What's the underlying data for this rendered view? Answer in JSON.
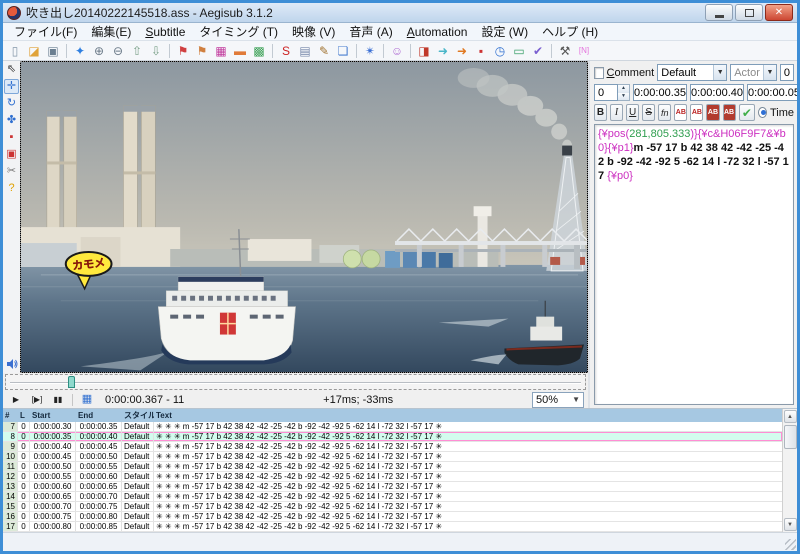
{
  "colors": {
    "accent_blue": "#3e8ed6",
    "grid_header_bg": "#a6c8e2",
    "selection_bg": "#d3fcee",
    "selection_border": "#ff8dd4",
    "tag_color": "#cc2fc0",
    "number_color": "#2f9e4f",
    "bubble_yellow": "#ffe93d",
    "bubble_text_red": "#d42a1e"
  },
  "window": {
    "title": "吹き出し20140222145518.ass - Aegisub 3.1.2"
  },
  "menu": {
    "items": [
      {
        "label": "ファイル(F)",
        "ak": false
      },
      {
        "label": "編集(E)",
        "ak": false
      },
      {
        "label": "Subtitle",
        "ak": true
      },
      {
        "label": "タイミング (T)",
        "ak": false
      },
      {
        "label": "映像 (V)",
        "ak": false
      },
      {
        "label": "音声 (A)",
        "ak": false
      },
      {
        "label": "Automation",
        "ak": true
      },
      {
        "label": "設定 (W)",
        "ak": false
      },
      {
        "label": "ヘルプ (H)",
        "ak": false
      }
    ]
  },
  "toolbar": {
    "items": [
      {
        "name": "new-file-icon",
        "glyph": "▯",
        "color": "#8496a8"
      },
      {
        "name": "open-file-icon",
        "glyph": "◪",
        "color": "#e0a33a"
      },
      {
        "name": "save-file-icon",
        "glyph": "▣",
        "color": "#6b7f91"
      },
      {
        "sep": true
      },
      {
        "name": "jump-to-icon",
        "glyph": "✦",
        "color": "#2f7fe0"
      },
      {
        "name": "zoom-in-icon",
        "glyph": "⊕",
        "color": "#6b7a88"
      },
      {
        "name": "zoom-out-icon",
        "glyph": "⊖",
        "color": "#6b7a88"
      },
      {
        "name": "sort-start-icon",
        "glyph": "⇧",
        "color": "#7aa089"
      },
      {
        "name": "sort-end-icon",
        "glyph": "⇩",
        "color": "#7aa089"
      },
      {
        "sep": true
      },
      {
        "name": "keyframe-prev-icon",
        "glyph": "⚑",
        "color": "#d04040"
      },
      {
        "name": "keyframe-next-icon",
        "glyph": "⚑",
        "color": "#d08040"
      },
      {
        "name": "styles-manager-icon",
        "glyph": "▦",
        "color": "#c23c9e"
      },
      {
        "name": "attachments-icon",
        "glyph": "▬",
        "color": "#e07b39"
      },
      {
        "name": "resample-resolution-icon",
        "glyph": "▩",
        "color": "#3aa055"
      },
      {
        "sep": true
      },
      {
        "name": "spell-checker-icon",
        "glyph": "S",
        "color": "#cc2222"
      },
      {
        "name": "script-properties-icon",
        "glyph": "▤",
        "color": "#7788aa"
      },
      {
        "name": "styling-assistant-icon",
        "glyph": "✎",
        "color": "#a0722f"
      },
      {
        "name": "translation-assistant-icon",
        "glyph": "❏",
        "color": "#4a7fd0"
      },
      {
        "sep": true
      },
      {
        "name": "automation-icon",
        "glyph": "✴",
        "color": "#3a6fd4"
      },
      {
        "sep": true
      },
      {
        "name": "about-icon",
        "glyph": "☺",
        "color": "#b06fd4"
      },
      {
        "sep": true
      },
      {
        "name": "shift-times-icon",
        "glyph": "◨",
        "color": "#c0392b"
      },
      {
        "name": "timing-postprocessor-icon",
        "glyph": "➜",
        "color": "#49b6c8"
      },
      {
        "name": "kanji-timer-icon",
        "glyph": "➜",
        "color": "#e07820"
      },
      {
        "name": "snap-icon",
        "glyph": "▪",
        "color": "#cc3333"
      },
      {
        "name": "shift-clock-icon",
        "glyph": "◷",
        "color": "#2f6fd0"
      },
      {
        "name": "script-resolution-icon",
        "glyph": "▭",
        "color": "#3aa06a"
      },
      {
        "name": "check-updates-icon",
        "glyph": "✔",
        "color": "#7a5fd0"
      },
      {
        "sep": true
      },
      {
        "name": "options-icon",
        "glyph": "⚒",
        "color": "#555555"
      },
      {
        "name": "toggle-tags-icon",
        "glyph": "[N]",
        "color": "#e473dd"
      }
    ]
  },
  "video_tools": {
    "items": [
      {
        "name": "cursor-tool-icon",
        "glyph": "⇖",
        "color": "#333333",
        "selected": false
      },
      {
        "name": "drag-tool-icon",
        "glyph": "✛",
        "color": "#2f6fd0",
        "selected": true
      },
      {
        "name": "rotate-z-tool-icon",
        "glyph": "↻",
        "color": "#2f6fd0",
        "selected": false
      },
      {
        "name": "rotate-xy-tool-icon",
        "glyph": "✤",
        "color": "#2f6fd0",
        "selected": false
      },
      {
        "name": "scale-tool-icon",
        "glyph": "▪",
        "color": "#cc3333",
        "selected": false
      },
      {
        "name": "clip-tool-icon",
        "glyph": "▣",
        "color": "#cc3333",
        "selected": false
      },
      {
        "name": "vector-clip-tool-icon",
        "glyph": "✂",
        "color": "#777777",
        "selected": false
      },
      {
        "name": "help-tool-icon",
        "glyph": "?",
        "color": "#e0a000",
        "selected": false
      }
    ]
  },
  "video": {
    "bubble_text": "カモメ"
  },
  "video_controls": {
    "buttons": [
      {
        "name": "play-button",
        "glyph": "▶"
      },
      {
        "name": "play-line-button",
        "glyph": "[▶]"
      },
      {
        "name": "pause-button",
        "glyph": "▮▮"
      }
    ],
    "autoseek_glyph": "▦",
    "time_label": "0:00:00.367 - 11",
    "delta_label": "+17ms; -33ms",
    "zoom_value": "50%"
  },
  "edit": {
    "comment_label": "Comment",
    "style_value": "Default",
    "actor_placeholder": "Actor",
    "margin_value": "0",
    "layer_value": "0",
    "start_value": "0:00:00.35",
    "end_value": "0:00:00.40",
    "duration_value": "0:00:00.05",
    "format_buttons": [
      {
        "name": "bold-button",
        "label": "B",
        "cls": "b"
      },
      {
        "name": "italic-button",
        "label": "I",
        "cls": "i"
      },
      {
        "name": "underline-button",
        "label": "U",
        "cls": "u"
      },
      {
        "name": "strikeout-button",
        "label": "S",
        "cls": "s"
      },
      {
        "name": "font-face-button",
        "label": "fn",
        "cls": "fn"
      }
    ],
    "color_buttons": [
      {
        "name": "primary-color-button",
        "label": "AB",
        "fg": "#bb2222",
        "bg": "#ffffff"
      },
      {
        "name": "secondary-color-button",
        "label": "AB",
        "fg": "#bb2222",
        "bg": "#ffffff"
      },
      {
        "name": "outline-color-button",
        "label": "AB",
        "fg": "#ffffff",
        "bg": "#b23b2e"
      },
      {
        "name": "shadow-color-button",
        "label": "AB",
        "fg": "#ffffff",
        "bg": "#b23b2e"
      }
    ],
    "commit_glyph": "✔",
    "time_radio_label": "Time",
    "segments": [
      {
        "text": "{¥pos(",
        "type": "tag"
      },
      {
        "text": "281,805.333",
        "type": "number"
      },
      {
        "text": ")}",
        "type": "tag"
      },
      {
        "text": "{¥c&H06F9F7&¥b0}",
        "type": "tag"
      },
      {
        "text": "{¥p1}",
        "type": "tag"
      },
      {
        "text": "m -57 17 b 42 38 42 -42 -25 -42 b -92 -42 -92 5 -62 14 l -72 32 l -57 17 ",
        "type": "plain"
      },
      {
        "text": "{¥p0}",
        "type": "tag"
      }
    ]
  },
  "grid": {
    "headers": [
      "#",
      "L",
      "Start",
      "End",
      "スタイル",
      "Text"
    ],
    "selected_num": "8",
    "line_text": "✳ ✳ ✳ m -57 17 b 42 38 42 -42 -25 -42 b -92 -42 -92 5 -62 14 l -72 32 l -57 17 ✳",
    "rows": [
      {
        "num": "7",
        "layer": "0",
        "start": "0:00:00.30",
        "end": "0:00:00.35",
        "style": "Default"
      },
      {
        "num": "8",
        "layer": "0",
        "start": "0:00:00.35",
        "end": "0:00:00.40",
        "style": "Default"
      },
      {
        "num": "9",
        "layer": "0",
        "start": "0:00:00.40",
        "end": "0:00:00.45",
        "style": "Default"
      },
      {
        "num": "10",
        "layer": "0",
        "start": "0:00:00.45",
        "end": "0:00:00.50",
        "style": "Default"
      },
      {
        "num": "11",
        "layer": "0",
        "start": "0:00:00.50",
        "end": "0:00:00.55",
        "style": "Default"
      },
      {
        "num": "12",
        "layer": "0",
        "start": "0:00:00.55",
        "end": "0:00:00.60",
        "style": "Default"
      },
      {
        "num": "13",
        "layer": "0",
        "start": "0:00:00.60",
        "end": "0:00:00.65",
        "style": "Default"
      },
      {
        "num": "14",
        "layer": "0",
        "start": "0:00:00.65",
        "end": "0:00:00.70",
        "style": "Default"
      },
      {
        "num": "15",
        "layer": "0",
        "start": "0:00:00.70",
        "end": "0:00:00.75",
        "style": "Default"
      },
      {
        "num": "16",
        "layer": "0",
        "start": "0:00:00.75",
        "end": "0:00:00.80",
        "style": "Default"
      },
      {
        "num": "17",
        "layer": "0",
        "start": "0:00:00.80",
        "end": "0:00:00.85",
        "style": "Default"
      }
    ]
  }
}
